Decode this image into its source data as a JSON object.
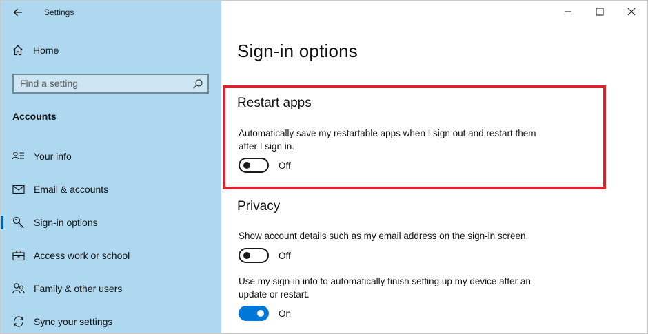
{
  "window": {
    "title": "Settings",
    "controls": [
      "minimize",
      "maximize",
      "close"
    ]
  },
  "sidebar": {
    "home_label": "Home",
    "search": {
      "placeholder": "Find a setting",
      "value": ""
    },
    "section_heading": "Accounts",
    "items": [
      {
        "label": "Your info",
        "icon": "person-list-icon",
        "selected": false
      },
      {
        "label": "Email & accounts",
        "icon": "mail-icon",
        "selected": false
      },
      {
        "label": "Sign-in options",
        "icon": "key-icon",
        "selected": true
      },
      {
        "label": "Access work or school",
        "icon": "briefcase-icon",
        "selected": false
      },
      {
        "label": "Family & other users",
        "icon": "people-icon",
        "selected": false
      },
      {
        "label": "Sync your settings",
        "icon": "sync-icon",
        "selected": false
      }
    ]
  },
  "main": {
    "page_title": "Sign-in options",
    "restart_apps": {
      "heading": "Restart apps",
      "description": "Automatically save my restartable apps when I sign out and restart them after I sign in.",
      "toggle_state": "Off",
      "toggle_on": false
    },
    "privacy": {
      "heading": "Privacy",
      "account_details": {
        "description": "Show account details such as my email address on the sign-in screen.",
        "toggle_state": "Off",
        "toggle_on": false
      },
      "signin_info": {
        "description": "Use my sign-in info to automatically finish setting up my device after an update or restart.",
        "toggle_state": "On",
        "toggle_on": true
      }
    }
  },
  "colors": {
    "sidebar_bg": "#add8ef",
    "accent": "#0078d7",
    "highlight": "#d9232e"
  }
}
